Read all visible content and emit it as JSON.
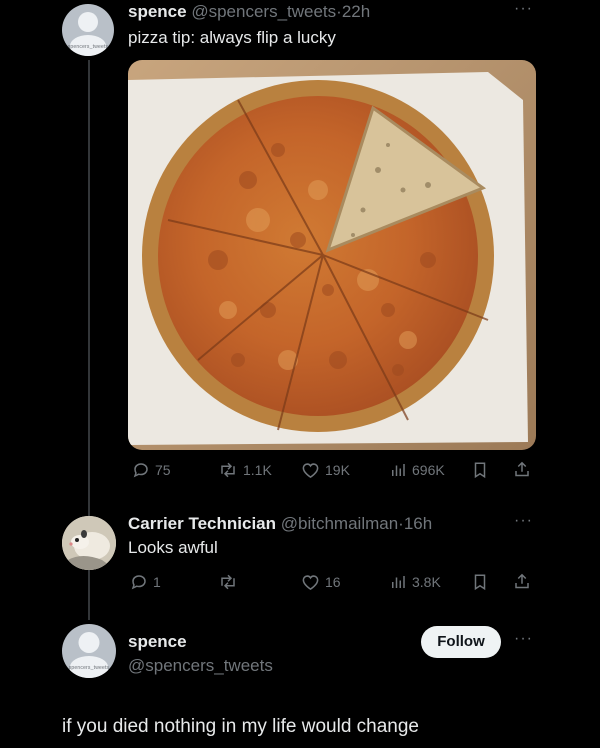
{
  "tweet": {
    "display_name": "spence",
    "handle": "@spencers_tweets",
    "separator": "·",
    "time": "22h",
    "text": "pizza tip: always flip a lucky",
    "more_icon": "more-dots-icon",
    "avatar_tag": "spencers_tweets",
    "stats": {
      "replies": "75",
      "retweets": "1.1K",
      "likes": "19K",
      "views": "696K"
    }
  },
  "reply": {
    "display_name": "Carrier Technician",
    "handle": "@bitchmailman",
    "separator": "·",
    "time": "16h",
    "text": "Looks awful",
    "stats": {
      "replies": "1",
      "retweets": "",
      "likes": "16",
      "views": "3.8K"
    }
  },
  "response": {
    "display_name": "spence",
    "handle": "@spencers_tweets",
    "follow_label": "Follow",
    "avatar_tag": "spencers_tweets",
    "text": "if you died nothing in my life would change"
  },
  "colors": {
    "background": "#000000",
    "text": "#e7e9ea",
    "muted": "#71767b",
    "follow_bg": "#eff3f4"
  }
}
